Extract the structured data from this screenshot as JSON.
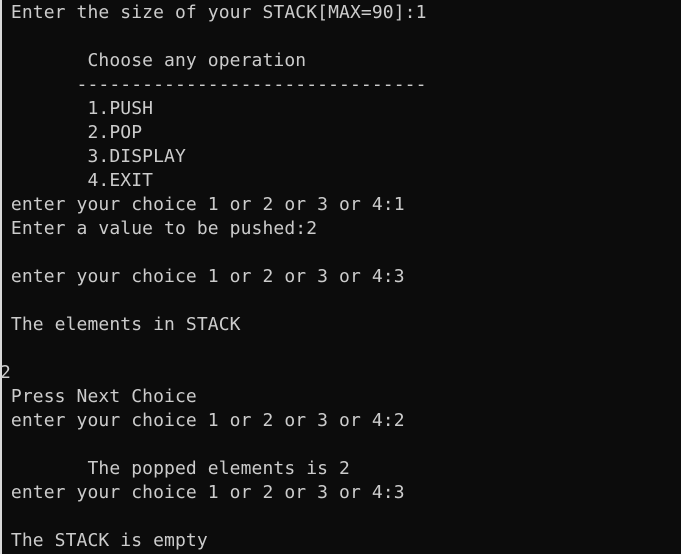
{
  "console": {
    "lines": [
      " Enter the size of your STACK[MAX=90]:1",
      "",
      "        Choose any operation",
      "       --------------------------------",
      "        1.PUSH",
      "        2.POP",
      "        3.DISPLAY",
      "        4.EXIT",
      " enter your choice 1 or 2 or 3 or 4:1",
      " Enter a value to be pushed:2",
      "",
      " enter your choice 1 or 2 or 3 or 4:3",
      "",
      " The elements in STACK",
      "",
      "2",
      " Press Next Choice",
      " enter your choice 1 or 2 or 3 or 4:2",
      "",
      "        The popped elements is 2",
      " enter your choice 1 or 2 or 3 or 4:3",
      "",
      " The STACK is empty"
    ]
  }
}
